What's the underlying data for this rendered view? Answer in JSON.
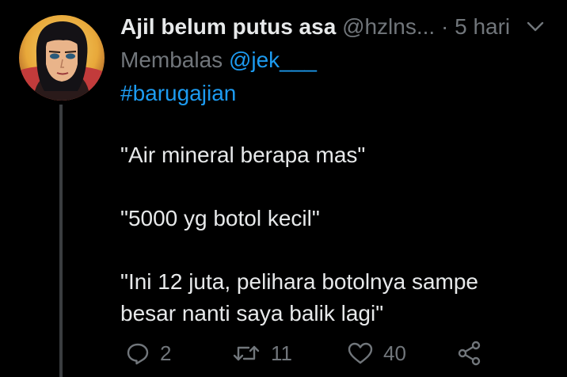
{
  "tweet": {
    "author": {
      "display_name": "Ajil belum putus asa",
      "handle": "@hzlns...",
      "avatar_icon": "anime-avatar"
    },
    "separator": "·",
    "time": "5 hari",
    "reply_prefix": "Membalas",
    "reply_to": "@jek___",
    "hashtag": "#barugajian",
    "lines": [
      "\"Air mineral berapa mas\"",
      "\"5000 yg botol kecil\"",
      "\"Ini 12 juta, pelihara botolnya sampe",
      "besar nanti saya balik lagi\""
    ],
    "actions": {
      "reply_count": "2",
      "retweet_count": "11",
      "like_count": "40"
    }
  },
  "colors": {
    "background": "#000000",
    "text": "#e7e9ea",
    "muted": "#71767b",
    "accent": "#1d9bf0"
  }
}
